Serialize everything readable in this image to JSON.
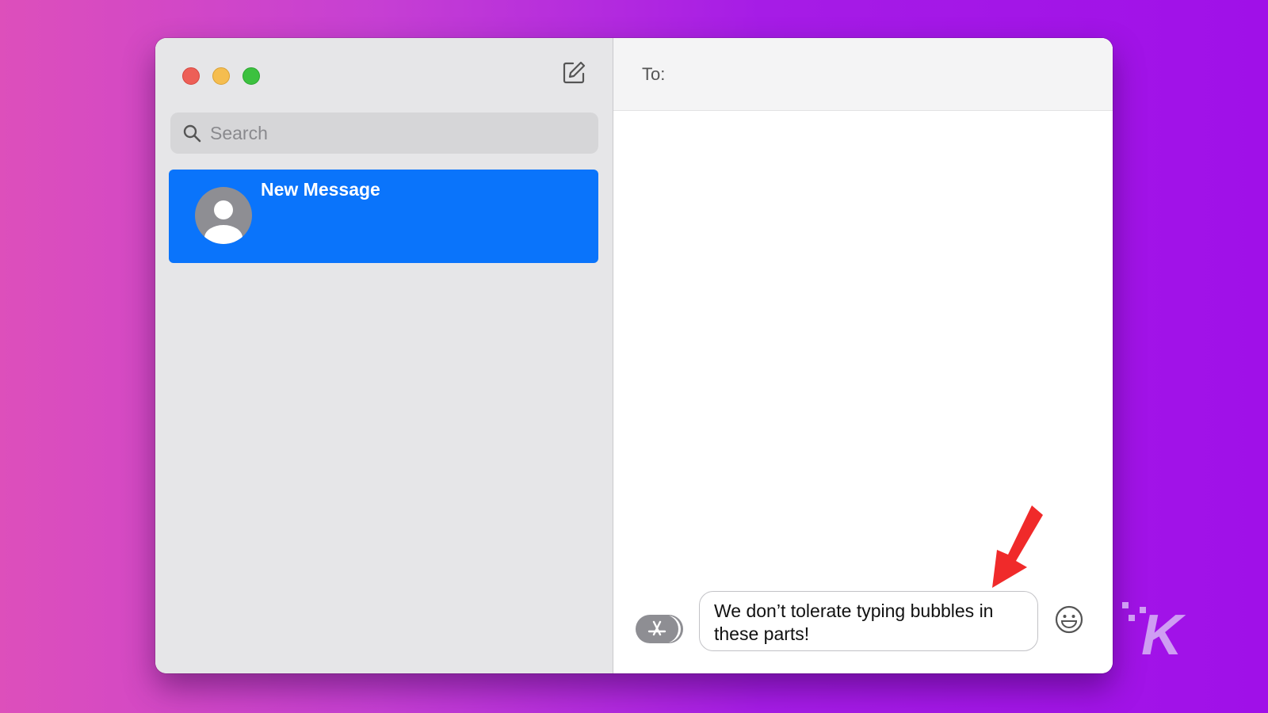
{
  "window": {
    "traffic_lights": [
      "close",
      "minimize",
      "zoom"
    ],
    "compose_icon": "compose-icon"
  },
  "sidebar": {
    "search": {
      "placeholder": "Search",
      "value": "",
      "icon": "search-icon"
    },
    "conversations": [
      {
        "title": "New Message",
        "selected": true,
        "avatar": "person-avatar"
      }
    ]
  },
  "main": {
    "to_label": "To:",
    "to_value": "",
    "message_text": "We don’t tolerate typing bubbles in these parts!",
    "apps_icon": "app-store-icon",
    "emoji_icon": "emoji-icon"
  },
  "overlay": {
    "annotation": "red-arrow",
    "watermark": "K"
  },
  "colors": {
    "selection": "#0a74fb",
    "close": "#ed5f57",
    "minimize": "#f5bd4f",
    "zoom": "#3cc13f",
    "arrow": "#f02a2a"
  }
}
